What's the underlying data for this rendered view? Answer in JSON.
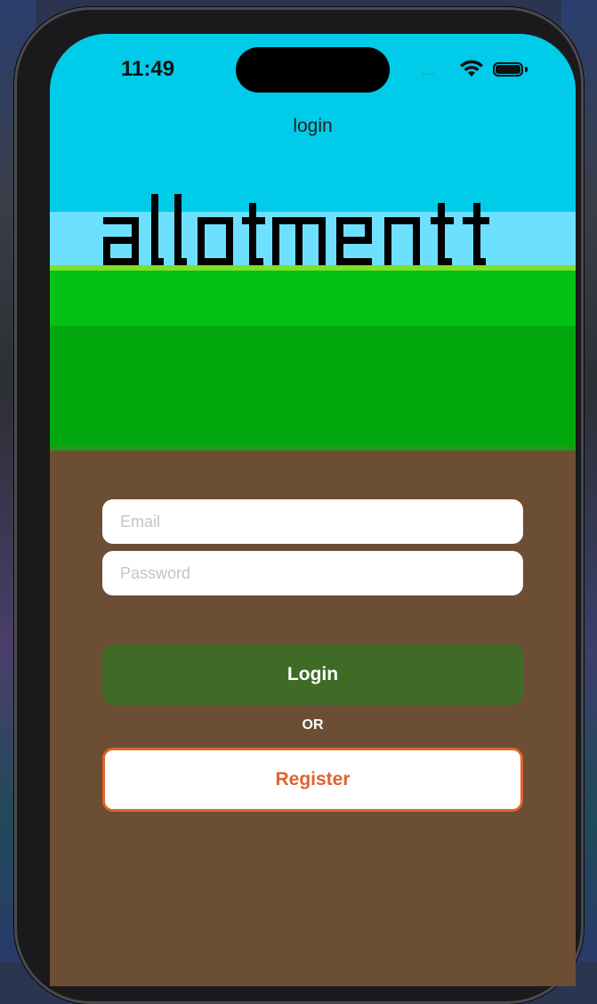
{
  "status_bar": {
    "time": "11:49",
    "signal": "....",
    "icons": [
      "wifi-icon",
      "battery-icon"
    ]
  },
  "nav": {
    "title": "login"
  },
  "logo": {
    "text": "allotment"
  },
  "form": {
    "email_placeholder": "Email",
    "email_value": "",
    "password_placeholder": "Password",
    "password_value": "",
    "login_label": "Login",
    "or_label": "OR",
    "register_label": "Register"
  },
  "colors": {
    "sky": "#00cbe8",
    "grass": "#04c115",
    "dirt": "#6b4e33",
    "login_button": "#3f6b27",
    "register_accent": "#e2622b"
  }
}
